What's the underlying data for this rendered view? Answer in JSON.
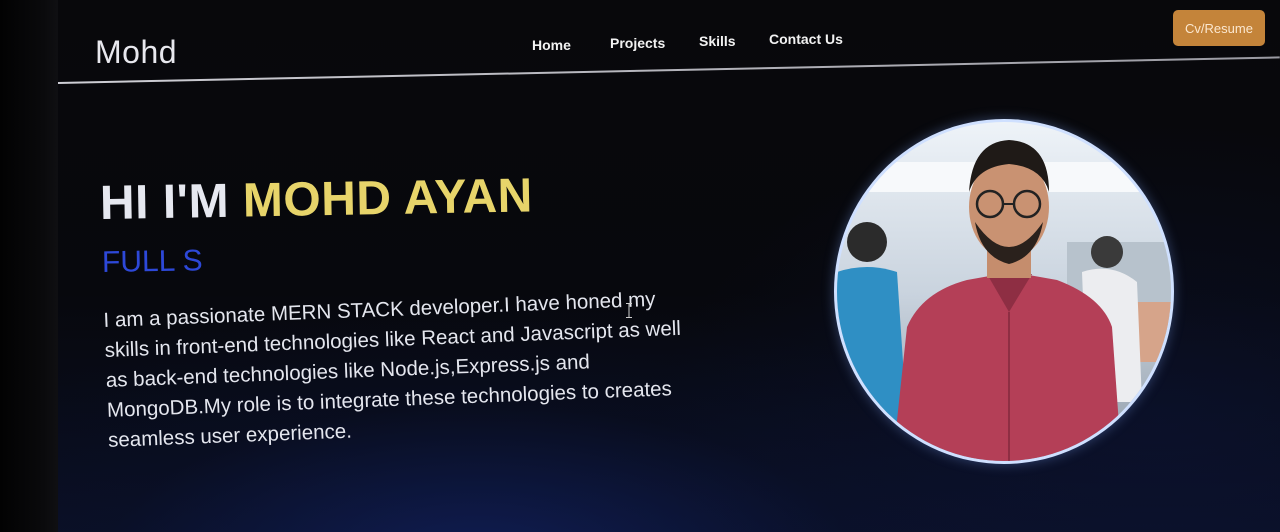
{
  "brand": {
    "name": "Mohd"
  },
  "nav": {
    "items": [
      "Home",
      "Projects",
      "Skills",
      "Contact Us"
    ]
  },
  "actions": {
    "cv_label": "Cv/Resume"
  },
  "hero": {
    "greeting": "HI I'M ",
    "name": "MOHD AYAN",
    "role": "FULL S",
    "bio": "I am a passionate MERN STACK developer.I have honed my skills in front-end technologies like React and Javascript as well as back-end technologies like Node.js,Express.js and MongoDB.My role is to integrate these technologies to creates seamless user experience."
  },
  "colors": {
    "accent_name": "#e7d46a",
    "accent_role": "#2d48d8",
    "button": "#c4843a"
  },
  "icons": {
    "cursor": "text-cursor-icon"
  }
}
